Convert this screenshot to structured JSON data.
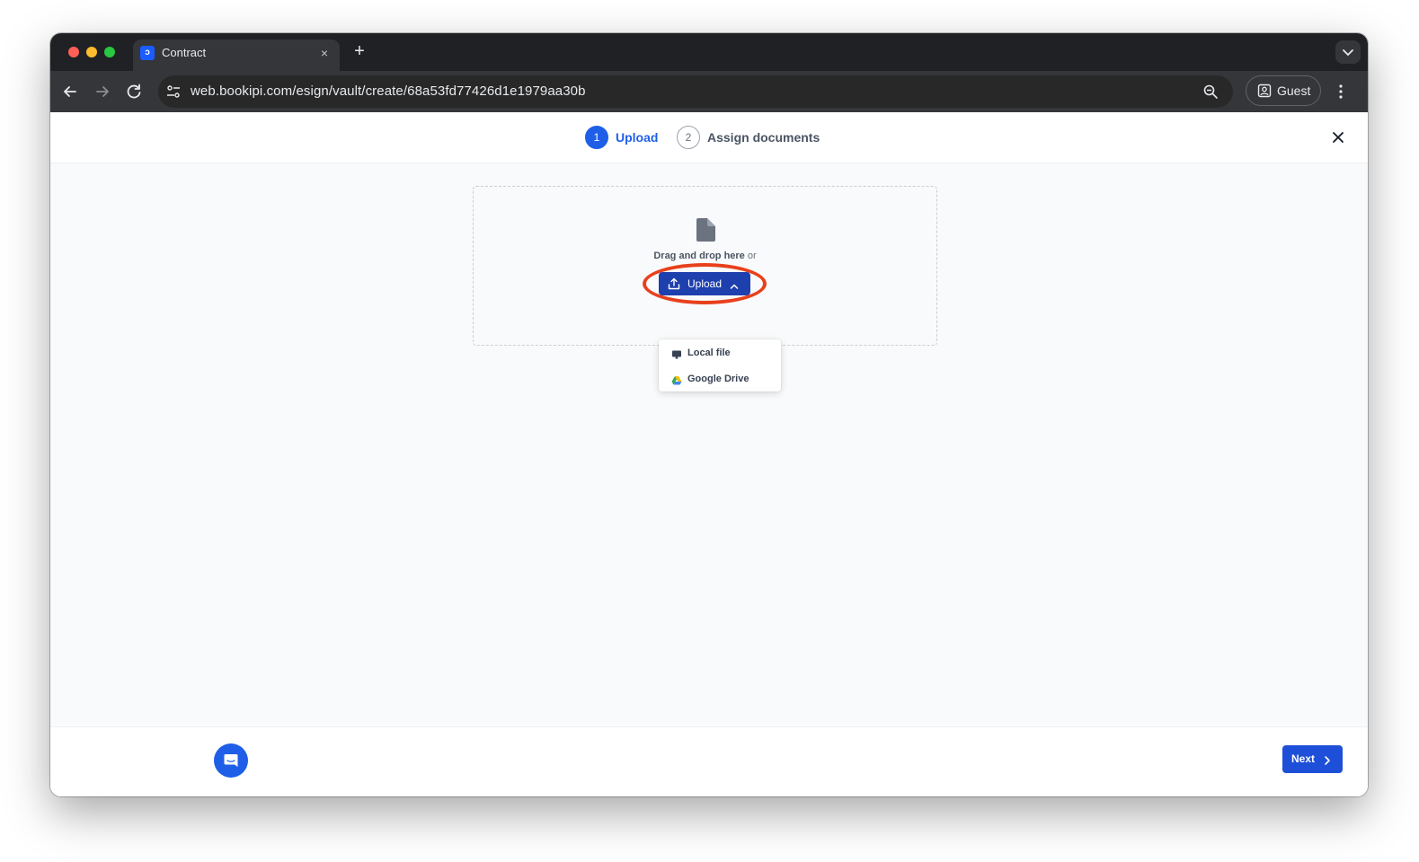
{
  "browser": {
    "tab": {
      "title": "Contract",
      "favicon": "bookipi-logo",
      "close": "×"
    },
    "new_tab": "+",
    "url": "web.bookipi.com/esign/vault/create/68a53fd77426d1e1979aa30b",
    "profile_label": "Guest"
  },
  "stepper": {
    "steps": [
      {
        "number": "1",
        "label": "Upload",
        "state": "active"
      },
      {
        "number": "2",
        "label": "Assign documents",
        "state": "inactive"
      }
    ]
  },
  "dropzone": {
    "prompt_bold": "Drag and drop here",
    "prompt_suffix": " or",
    "upload_button": "Upload"
  },
  "upload_menu": {
    "items": [
      {
        "label": "Local file",
        "icon": "computer-icon"
      },
      {
        "label": "Google Drive",
        "icon": "google-drive-icon"
      }
    ]
  },
  "footer": {
    "next_button": "Next"
  },
  "colors": {
    "primary": "#1f5fe8",
    "upload_button": "#1e3fae",
    "highlight": "#e8401c"
  }
}
